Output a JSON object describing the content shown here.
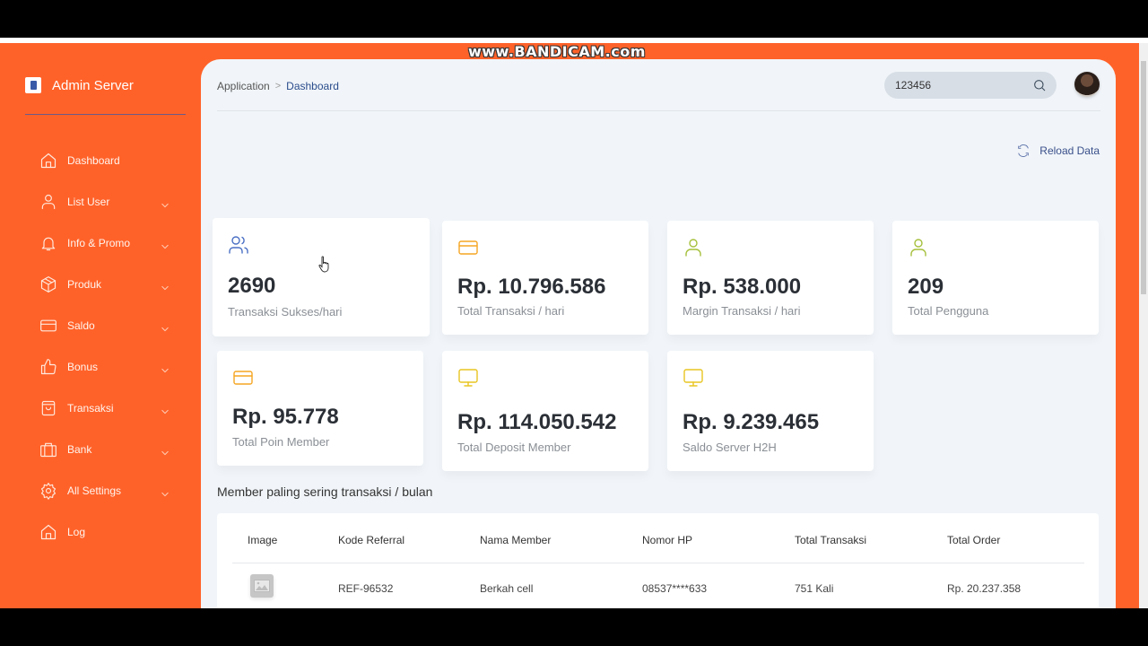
{
  "watermark": "www.BANDICAM.com",
  "brand": {
    "name": "Admin Server"
  },
  "colors": {
    "sidebar_bg": "#ff6229",
    "main_bg": "#f1f5f9",
    "accent_blue": "#2a4c8c",
    "icon_orange": "#f5a623",
    "icon_green": "#a5c03c",
    "icon_yellow": "#e8c521",
    "icon_blue": "#4a6fc4"
  },
  "sidebar": {
    "items": [
      {
        "label": "Dashboard",
        "icon": "home-icon",
        "has_chevron": false
      },
      {
        "label": "List User",
        "icon": "user-icon",
        "has_chevron": true
      },
      {
        "label": "Info & Promo",
        "icon": "bell-icon",
        "has_chevron": true
      },
      {
        "label": "Produk",
        "icon": "box-icon",
        "has_chevron": true
      },
      {
        "label": "Saldo",
        "icon": "credit-card-icon",
        "has_chevron": true
      },
      {
        "label": "Bonus",
        "icon": "thumbs-up-icon",
        "has_chevron": true
      },
      {
        "label": "Transaksi",
        "icon": "shopping-bag-icon",
        "has_chevron": true
      },
      {
        "label": "Bank",
        "icon": "briefcase-icon",
        "has_chevron": true
      },
      {
        "label": "All Settings",
        "icon": "gear-icon",
        "has_chevron": true
      },
      {
        "label": "Log",
        "icon": "home-icon",
        "has_chevron": false
      }
    ]
  },
  "header": {
    "breadcrumb": [
      "Application",
      "Dashboard"
    ],
    "breadcrumb_separator": ">",
    "search": {
      "value": "123456",
      "placeholder": ""
    }
  },
  "actions": {
    "reload_label": "Reload Data"
  },
  "stats": [
    {
      "value": "2690",
      "label": "Transaksi Sukses/hari",
      "icon": "users-icon"
    },
    {
      "value": "Rp. 10.796.586",
      "label": "Total Transaksi / hari",
      "icon": "credit-card-icon"
    },
    {
      "value": "Rp. 538.000",
      "label": "Margin Transaksi / hari",
      "icon": "user-icon"
    },
    {
      "value": "209",
      "label": "Total Pengguna",
      "icon": "user-icon"
    },
    {
      "value": "Rp. 95.778",
      "label": "Total Poin Member",
      "icon": "credit-card-icon"
    },
    {
      "value": "Rp. 114.050.542",
      "label": "Total Deposit Member",
      "icon": "monitor-icon"
    },
    {
      "value": "Rp. 9.239.465",
      "label": "Saldo Server H2H",
      "icon": "monitor-icon"
    }
  ],
  "table": {
    "title": "Member paling sering transaksi / bulan",
    "columns": [
      "Image",
      "Kode Referral",
      "Nama Member",
      "Nomor HP",
      "Total Transaksi",
      "Total Order"
    ],
    "rows": [
      {
        "image": "image-placeholder-icon",
        "kode_referral": "REF-96532",
        "nama_member": "Berkah cell",
        "nomor_hp": "08537****633",
        "total_transaksi": "751 Kali",
        "total_order": "Rp. 20.237.358"
      }
    ]
  }
}
